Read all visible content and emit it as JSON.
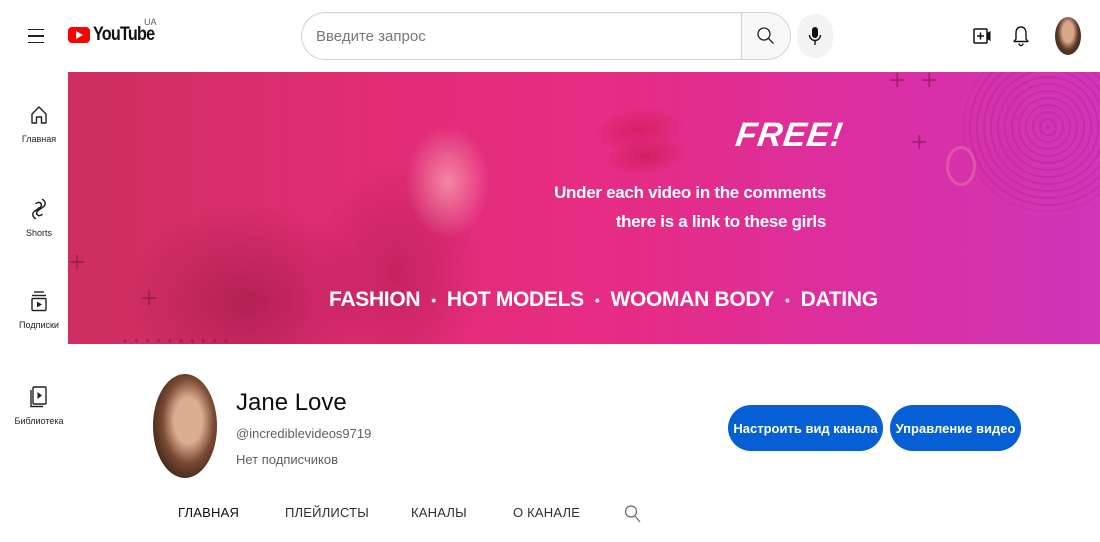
{
  "header": {
    "logo_text": "YouTube",
    "country_code": "UA",
    "search_placeholder": "Введите запрос",
    "icons": [
      "menu-icon",
      "search-icon",
      "mic-icon",
      "create-video-icon",
      "bell-icon"
    ]
  },
  "sidebar": {
    "items": [
      {
        "label": "Главная",
        "icon": "home-icon"
      },
      {
        "label": "Shorts",
        "icon": "shorts-icon"
      },
      {
        "label": "Подписки",
        "icon": "subscriptions-icon"
      },
      {
        "label": "Библиотека",
        "icon": "library-icon"
      }
    ]
  },
  "banner": {
    "free_text": "FREE!",
    "line_1": "Under each video in the comments",
    "line_2": "there is a link to these girls",
    "tags": [
      "FASHION",
      "HOT MODELS",
      "WOOMAN BODY",
      "DATING"
    ],
    "separator": "•",
    "colors": {
      "start": "#e0386c",
      "end": "#cf36b8"
    }
  },
  "channel": {
    "name": "Jane Love",
    "handle": "@incrediblevideos9719",
    "subscribers": "Нет подписчиков",
    "buttons": {
      "customize": "Настроить вид канала",
      "manage": "Управление видео"
    },
    "accent_color": "#065fd4"
  },
  "tabs": [
    {
      "label": "ГЛАВНАЯ"
    },
    {
      "label": "ПЛЕЙЛИСТЫ"
    },
    {
      "label": "КАНАЛЫ"
    },
    {
      "label": "О КАНАЛЕ"
    }
  ]
}
